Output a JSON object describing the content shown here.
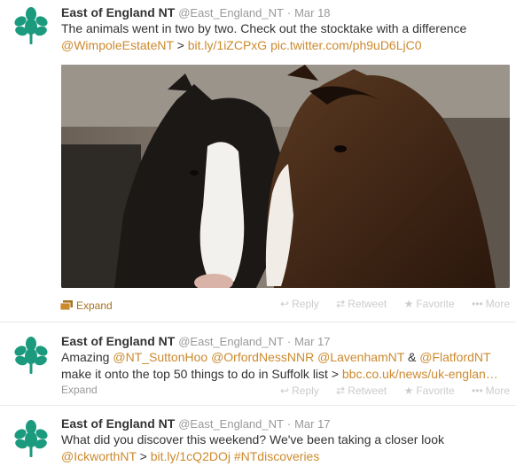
{
  "colors": {
    "link": "#cc8a2e",
    "text": "#333333",
    "muted": "#999999",
    "action": "#cccccc",
    "avatar_green": "#1b9a7e"
  },
  "tweets": [
    {
      "fullname": "East of England NT",
      "username": "@East_England_NT",
      "separator": "·",
      "time": "Mar 18",
      "line1": "The animals went in two by two. Check out the stocktake with a difference",
      "line2_mention": "@WimpoleEstateNT",
      "line2_sep": " > ",
      "line2_link1": "bit.ly/1iZCPxG",
      "line2_link2": "pic.twitter.com/ph9uD6LjC0",
      "expand": "Expand",
      "media_alt": "photo",
      "actions": {
        "reply": "Reply",
        "retweet": "Retweet",
        "favorite": "Favorite",
        "more": "More"
      }
    },
    {
      "fullname": "East of England NT",
      "username": "@East_England_NT",
      "separator": "·",
      "time": "Mar 17",
      "line1_prefix": "Amazing ",
      "mention1": "@NT_SuttonHoo",
      "mention2": "@OrfordNessNNR",
      "mention3": "@LavenhamNT",
      "amp": " & ",
      "mention4": "@FlatfordNT",
      "line2_text": "make it onto the top 50 things to do in Suffolk list > ",
      "line2_link": "bbc.co.uk/news/uk-englan…",
      "expand": "Expand",
      "actions": {
        "reply": "Reply",
        "retweet": "Retweet",
        "favorite": "Favorite",
        "more": "More"
      }
    },
    {
      "fullname": "East of England NT",
      "username": "@East_England_NT",
      "separator": "·",
      "time": "Mar 17",
      "line1": "What did you discover this weekend? We've been taking a closer look",
      "line2_mention": "@IckworthNT",
      "line2_sep": " > ",
      "line2_link": "bit.ly/1cQ2DOj",
      "line2_hashtag": "#NTdiscoveries"
    }
  ]
}
